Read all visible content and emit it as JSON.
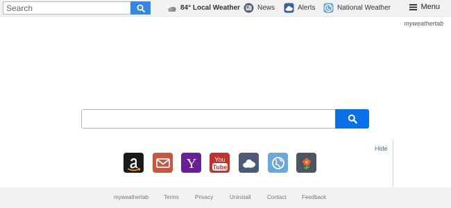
{
  "topbar": {
    "search_placeholder": "Search",
    "nav": [
      {
        "label": "84° Local Weather",
        "icon": "weather-cloud-icon"
      },
      {
        "label": "News",
        "icon": "news-icon"
      },
      {
        "label": "Alerts",
        "icon": "alerts-icon"
      },
      {
        "label": "National Weather",
        "icon": "globe-icon"
      }
    ],
    "menu_label": "Menu"
  },
  "brand": "myweathertab",
  "main_search": {
    "placeholder": ""
  },
  "hide_label": "Hide",
  "tiles": [
    {
      "name": "amazon",
      "color": "#1a1a1a"
    },
    {
      "name": "gmail",
      "color": "#c9563f"
    },
    {
      "name": "yahoo",
      "color": "#6a1f9a"
    },
    {
      "name": "youtube",
      "color": "#c4302b",
      "text_top": "You",
      "text_bottom": "Tube"
    },
    {
      "name": "weather",
      "color": "#4a5a78"
    },
    {
      "name": "globe",
      "color": "#6aa8d8"
    },
    {
      "name": "flower",
      "color": "#4d5561"
    }
  ],
  "footer": {
    "links": [
      "myweathertab",
      "Terms",
      "Privacy",
      "Uninstall",
      "Contact",
      "Feedback"
    ]
  },
  "colors": {
    "top_search_button": "#3a86df",
    "main_search_button": "#0b6fe8",
    "bar_bg": "#f2f2f2",
    "link": "#2a6fd0"
  }
}
